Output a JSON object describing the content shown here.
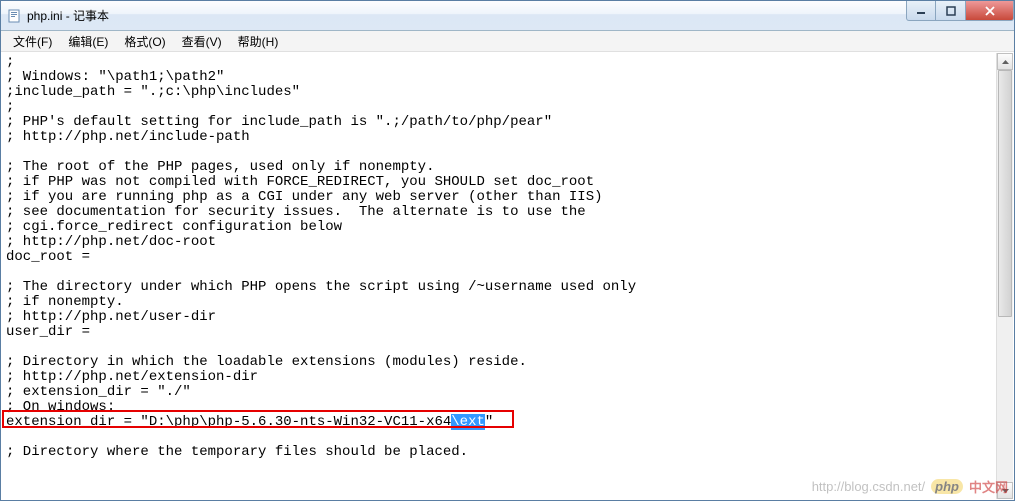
{
  "window": {
    "title": "php.ini - 记事本"
  },
  "menu": {
    "file": "文件(F)",
    "edit": "编辑(E)",
    "format": "格式(O)",
    "view": "查看(V)",
    "help": "帮助(H)"
  },
  "editor": {
    "l1": ";",
    "l2": "; Windows: \"\\path1;\\path2\"",
    "l3": ";include_path = \".;c:\\php\\includes\"",
    "l4": ";",
    "l5": "; PHP's default setting for include_path is \".;/path/to/php/pear\"",
    "l6": "; http://php.net/include-path",
    "l7": "",
    "l8": "; The root of the PHP pages, used only if nonempty.",
    "l9": "; if PHP was not compiled with FORCE_REDIRECT, you SHOULD set doc_root",
    "l10": "; if you are running php as a CGI under any web server (other than IIS)",
    "l11": "; see documentation for security issues.  The alternate is to use the",
    "l12": "; cgi.force_redirect configuration below",
    "l13": "; http://php.net/doc-root",
    "l14": "doc_root =",
    "l15": "",
    "l16": "; The directory under which PHP opens the script using /~username used only",
    "l17": "; if nonempty.",
    "l18": "; http://php.net/user-dir",
    "l19": "user_dir =",
    "l20": "",
    "l21": "; Directory in which the loadable extensions (modules) reside.",
    "l22": "; http://php.net/extension-dir",
    "l23": "; extension_dir = \"./\"",
    "l24": "; On windows:",
    "l25a": "extension_dir = \"D:\\php\\php-5.6.30-nts-Win32-VC11-x64",
    "l25sel": "\\ext",
    "l25b": "\"",
    "l26": "",
    "l27": "; Directory where the temporary files should be placed."
  },
  "watermark": {
    "url": "http://blog.csdn.net/",
    "badge": "php",
    "cn": "中文网"
  }
}
